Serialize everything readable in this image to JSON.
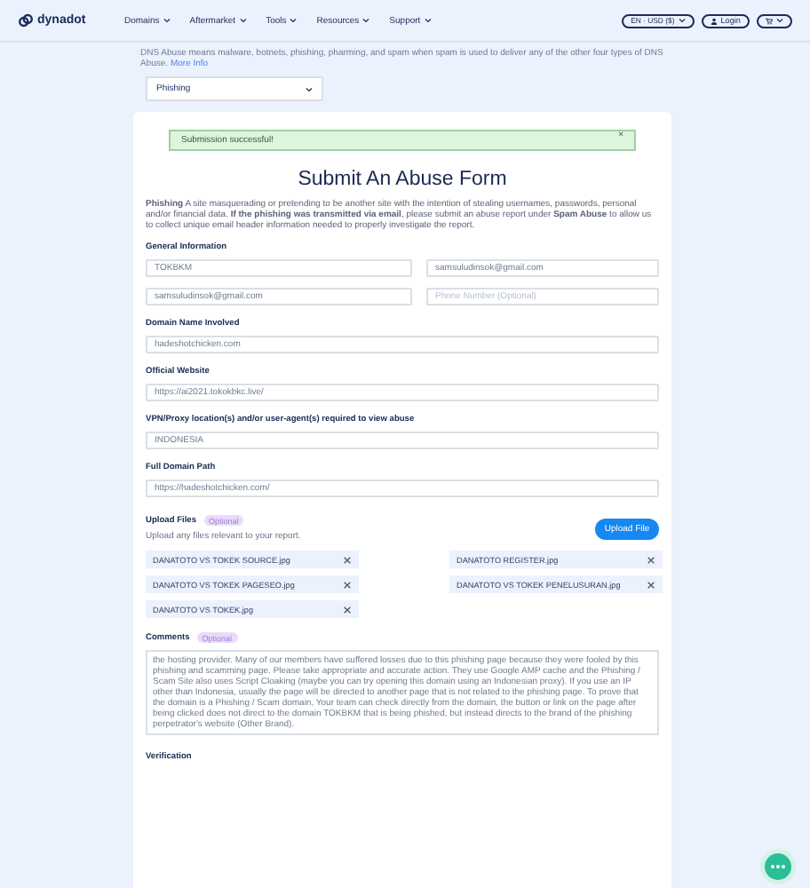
{
  "header": {
    "logo": "dynadot",
    "nav": [
      "Domains",
      "Aftermarket",
      "Tools",
      "Resources",
      "Support"
    ],
    "locale": "EN · USD ($)",
    "login": "Login"
  },
  "notice": {
    "text": "DNS Abuse means malware, botnets, phishing, pharming, and spam when spam is used to deliver any of the other four types of DNS Abuse.",
    "link": "More Info"
  },
  "abuse_type": {
    "value": "Phishing"
  },
  "alert": {
    "text": "Submission successful!",
    "close": "×"
  },
  "form": {
    "title": "Submit An Abuse Form",
    "intro": "**Phishing** A site masquerading or pretending to be another site with the intention of stealing usernames, passwords, personal and/or financial data. **If the phishing was transmitted via email**, please submit an abuse report under **Spam Abuse** to allow us to collect unique email header information needed to properly investigate the report.",
    "general_heading": "General Information",
    "general_fields": [
      {
        "value": "TOKBKM"
      },
      {
        "value": "samsuludinsok@gmail.com"
      },
      {
        "value": "samsuludinsok@gmail.com"
      },
      {
        "placeholder": "Phone Number (Optional)"
      }
    ],
    "sections": [
      {
        "label": "Domain Name Involved",
        "value": "hadeshotchicken.com"
      },
      {
        "label": "Official Website",
        "value": "https://ai2021.tokokbkc.live/"
      },
      {
        "label": "VPN/Proxy location(s) and/or user-agent(s) required to view abuse",
        "value": "INDONESIA"
      },
      {
        "label": "Full Domain Path",
        "value": "https://hadeshotchicken.com/"
      }
    ],
    "upload": {
      "label": "Upload Files",
      "badge": "Optional",
      "hint": "Upload any files relevant to your report.",
      "button": "Upload File",
      "files": [
        {
          "name": "DANATOTO VS TOKEK SOURCE.jpg"
        },
        {
          "name": "DANATOTO REGISTER.jpg"
        },
        {
          "name": "DANATOTO VS TOKEK PAGESEO.jpg"
        },
        {
          "name": "DANATOTO VS TOKEK PENELUSURAN.jpg"
        },
        {
          "name": "DANATOTO VS TOKEK.jpg"
        }
      ]
    },
    "comments": {
      "label": "Comments",
      "badge": "Optional",
      "value": "the hosting provider. Many of our members have suffered losses due to this phishing page because they were fooled by this phishing and scamming page. Please take appropriate and accurate action. They use Google AMP cache and the Phishing / Scam Site also uses Script Cloaking (maybe you can try opening this domain using an Indonesian proxy). If you use an IP other than Indonesia, usually the page will be directed to another page that is not related to the phishing page. To prove that the domain is a Phishing / Scam domain, Your team can check directly from the domain, the button or link on the page after being clicked does not direct to the domain TOKBKM that is being phished, but instead directs to the brand of the phishing perpetrator's website (Other Brand)."
    },
    "verification_heading": "Verification"
  }
}
